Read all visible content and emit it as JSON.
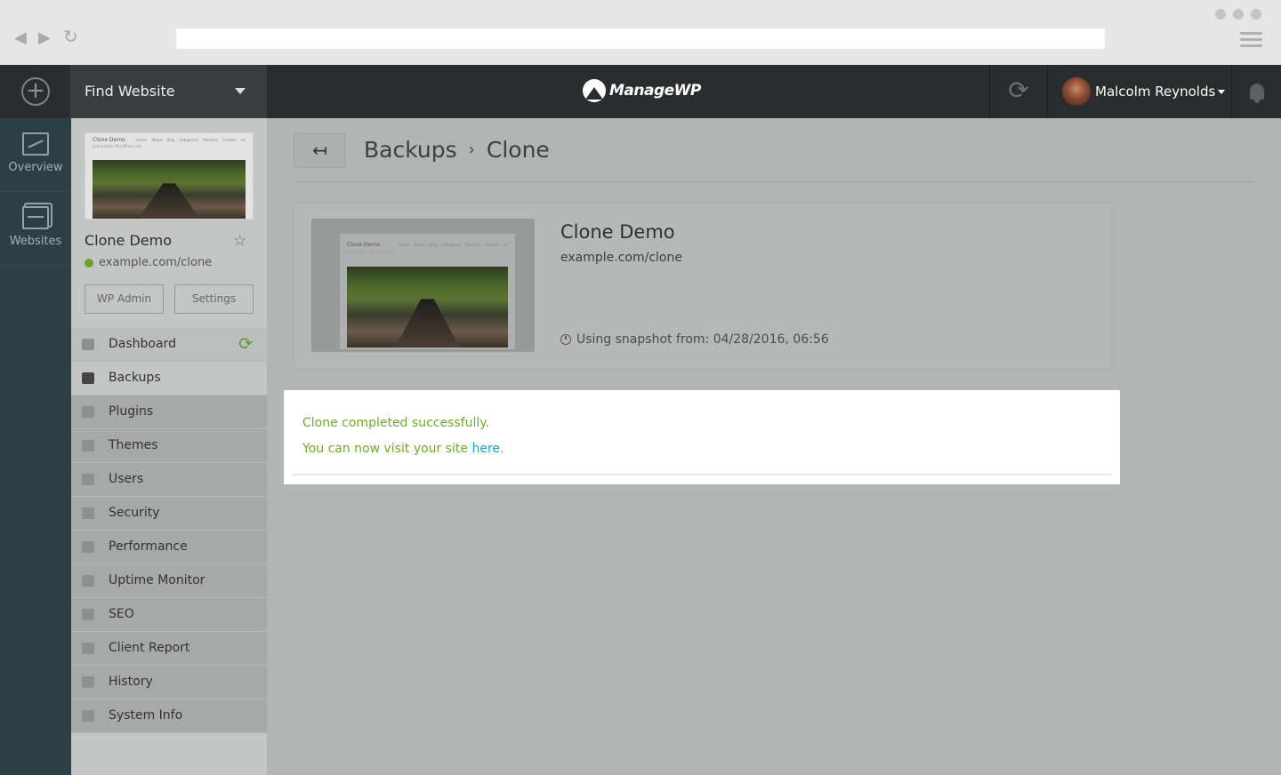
{
  "browser": {
    "back_icon": "back-arrow-icon",
    "forward_icon": "forward-arrow-icon",
    "reload_icon": "reload-icon",
    "url": "",
    "menu_icon": "hamburger-icon"
  },
  "topbar": {
    "add_icon": "plus-circle-icon",
    "find_website_label": "Find Website",
    "logo_text": "ManageWP",
    "user_name": "Malcolm Reynolds",
    "sync_icon": "sync-icon",
    "bell_icon": "bell-icon"
  },
  "leftnav": {
    "items": [
      {
        "label": "Overview",
        "icon": "monitor-chart-icon"
      },
      {
        "label": "Websites",
        "icon": "pages-icon"
      }
    ]
  },
  "site": {
    "name": "Clone Demo",
    "url": "example.com/clone",
    "status_color": "#6aa32a",
    "wp_admin_label": "WP Admin",
    "settings_label": "Settings",
    "thumb_title": "Clone Demo",
    "thumb_subtitle": "Just another WordPress site",
    "thumb_menu": "Home About Blog Categories Portfolio Contact Us"
  },
  "menu": [
    {
      "label": "Dashboard",
      "icon": "monitor-icon"
    },
    {
      "label": "Backups",
      "icon": "backup-drive-icon"
    },
    {
      "label": "Plugins",
      "icon": "plug-icon"
    },
    {
      "label": "Themes",
      "icon": "palette-icon"
    },
    {
      "label": "Users",
      "icon": "user-icon"
    },
    {
      "label": "Security",
      "icon": "shield-icon"
    },
    {
      "label": "Performance",
      "icon": "gauge-icon"
    },
    {
      "label": "Uptime Monitor",
      "icon": "arrow-up-icon"
    },
    {
      "label": "SEO",
      "icon": "megaphone-icon"
    },
    {
      "label": "Client Report",
      "icon": "chart-icon"
    },
    {
      "label": "History",
      "icon": "clock-icon"
    },
    {
      "label": "System Info",
      "icon": "server-icon"
    }
  ],
  "breadcrumb": {
    "back_icon": "left-arrow-icon",
    "items": [
      "Backups",
      "Clone"
    ],
    "separator": "›"
  },
  "clone": {
    "title": "Clone Demo",
    "url": "example.com/clone",
    "snapshot_text": "Using snapshot from: 04/28/2016, 06:56"
  },
  "alert": {
    "line1": "Clone completed successfully.",
    "line2_prefix": "You can now visit your site ",
    "line2_link": "here",
    "line2_suffix": ".",
    "success_color": "#6eaa2b",
    "link_color": "#1a9ec2"
  }
}
